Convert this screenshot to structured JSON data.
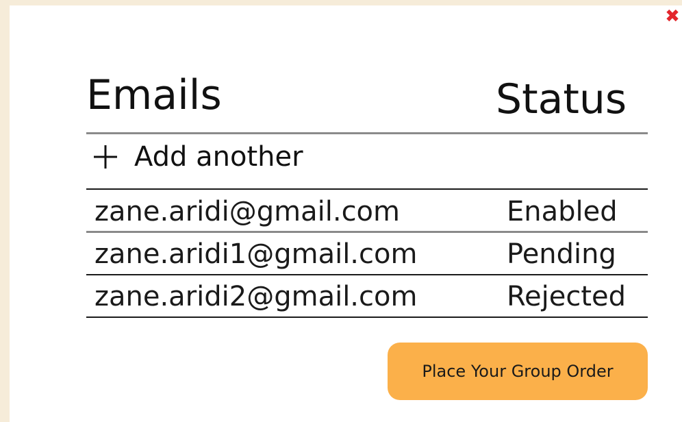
{
  "headings": {
    "emails": "Emails",
    "status": "Status"
  },
  "add_row": {
    "icon": "plus-icon",
    "label": "Add another"
  },
  "rows": [
    {
      "email": "zane.aridi@gmail.com",
      "status": "Enabled"
    },
    {
      "email": "zane.aridi1@gmail.com",
      "status": "Pending"
    },
    {
      "email": "zane.aridi2@gmail.com",
      "status": "Rejected"
    }
  ],
  "order_button": {
    "label": "Place Your Group Order"
  },
  "close_icon": "close-icon",
  "colors": {
    "button_bg": "#fbb04a",
    "close": "#e3262c",
    "page_bg": "#f6ecd9"
  }
}
